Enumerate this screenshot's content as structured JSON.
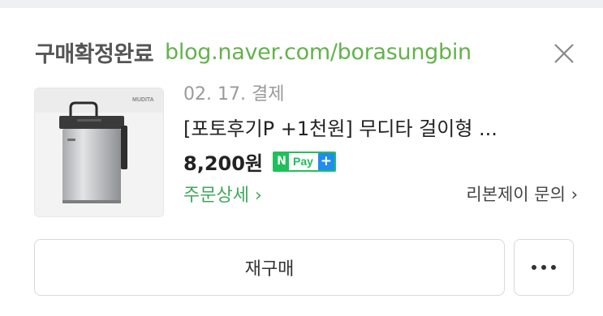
{
  "order_card": {
    "status_label": "구매확정완료",
    "store_url": "blog.naver.com/borasungbin",
    "order_date": "02. 17. 결제",
    "product_title": "[포토후기P +1천원] 무디타 걸이형 ...",
    "price": "8,200원",
    "payment_badge": {
      "n_mark": "N",
      "text": "Pay",
      "plus": "+"
    },
    "order_detail_link": "주문상세 ›",
    "store_inquiry_link": "리본제이 문의 ›",
    "rebuy_label": "재구매",
    "thumbnail_brand": "MUDITA"
  },
  "colors": {
    "store_url": "#62b34a",
    "link_green": "#3ea85a",
    "npay_green": "#20c05a",
    "npay_blue": "#1e8cf0"
  },
  "icons": {
    "close": "close-icon",
    "more": "more-dots-icon"
  }
}
